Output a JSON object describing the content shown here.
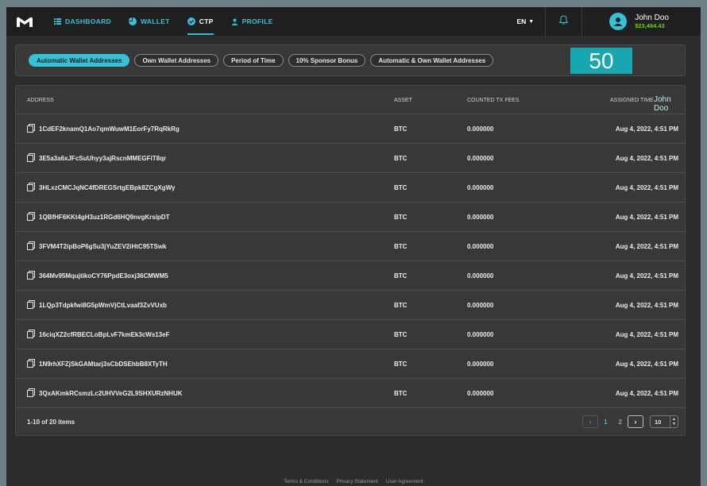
{
  "nav": {
    "items": [
      {
        "label": "DASHBOARD",
        "icon": "list-icon"
      },
      {
        "label": "WALLET",
        "icon": "pie-icon"
      },
      {
        "label": "CTP",
        "icon": "circle-check-icon"
      },
      {
        "label": "PROFILE",
        "icon": "person-icon"
      }
    ],
    "active": "CTP",
    "lang": "EN",
    "user_name": "John Doo",
    "user_balance": "$23,464.43"
  },
  "filters": {
    "pills": [
      "Automatic Wallet Addresses",
      "Own Wallet Addresses",
      "Period of Time",
      "10% Sponsor Bonus",
      "Automatic & Own Wallet Addresses"
    ],
    "active_index": 0,
    "count_badge": "50"
  },
  "table": {
    "headers": {
      "address": "ADDRESS",
      "asset": "ASSET",
      "fees": "COUNTED TX FEES",
      "time": "ASSIGNED TIME"
    },
    "header_overlay": "John Doo",
    "rows": [
      {
        "address": "1CdEF2knamQ1Ao7qmWuwM1EorFy7RqRkRg",
        "asset": "BTC",
        "fees": "0.000000",
        "time": "Aug 4, 2022, 4:51 PM"
      },
      {
        "address": "3E5a3a6xJFcSuUhyy3ajRscnMMEGFiT8qr",
        "asset": "BTC",
        "fees": "0.000000",
        "time": "Aug 4, 2022, 4:51 PM"
      },
      {
        "address": "3HLxzCMCJqNC4fDREGSrtgEBpk8ZCgXgWy",
        "asset": "BTC",
        "fees": "0.000000",
        "time": "Aug 4, 2022, 4:51 PM"
      },
      {
        "address": "1QBfHF6KKt4gH3uz1RGd6HQ9nvgKrsipDT",
        "asset": "BTC",
        "fees": "0.000000",
        "time": "Aug 4, 2022, 4:51 PM"
      },
      {
        "address": "3FVM4T2ipBoP6gSu3jYuZEV2iHtC95TSwk",
        "asset": "BTC",
        "fees": "0.000000",
        "time": "Aug 4, 2022, 4:51 PM"
      },
      {
        "address": "364Mv95MqujtikoCY76PpdE3oxj36CMWM5",
        "asset": "BTC",
        "fees": "0.000000",
        "time": "Aug 4, 2022, 4:51 PM"
      },
      {
        "address": "1LQp3Tdpkfwi8G5pWmVjCtLvaaf3ZvVUxb",
        "asset": "BTC",
        "fees": "0.000000",
        "time": "Aug 4, 2022, 4:51 PM"
      },
      {
        "address": "16ciqXZ2cfRBECLoBpLvF7kmEk3cWs13eF",
        "asset": "BTC",
        "fees": "0.000000",
        "time": "Aug 4, 2022, 4:51 PM"
      },
      {
        "address": "1N9rhXFZjSkGAMtarj3sCbDSEhbB8XTyTH",
        "asset": "BTC",
        "fees": "0.000000",
        "time": "Aug 4, 2022, 4:51 PM"
      },
      {
        "address": "3QxAKmkRCsmzLc2UHVVeG2L9SHXURzNHUK",
        "asset": "BTC",
        "fees": "0.000000",
        "time": "Aug 4, 2022, 4:51 PM"
      }
    ],
    "range_text": "1-10 of 20 items",
    "pages": [
      "1",
      "2"
    ],
    "current_page": "1",
    "page_size": "10"
  },
  "footer": {
    "links": [
      "Terms & Conditions",
      "Privacy Statement",
      "User Agreement"
    ]
  },
  "colors": {
    "accent": "#35c1d6",
    "balance": "#6fd400",
    "badge": "#16a7b0"
  }
}
